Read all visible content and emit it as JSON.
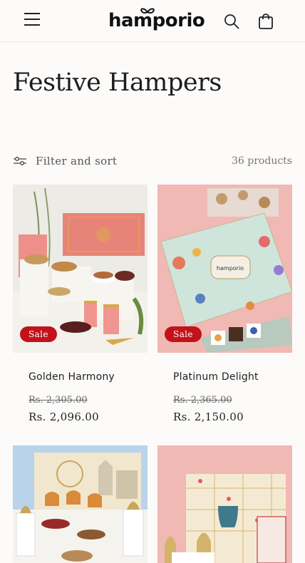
{
  "header": {
    "logo": "hamporio",
    "menu_icon": "hamburger-menu-icon",
    "search_icon": "search-icon",
    "cart_icon": "shopping-bag-icon"
  },
  "collection": {
    "title": "Festive Hampers",
    "filter_label": "Filter and sort",
    "product_count": "36 products"
  },
  "products": [
    {
      "name": "Golden Harmony",
      "badge": "Sale",
      "regular_price": "Rs. 2,305.00",
      "sale_price": "Rs. 2,096.00"
    },
    {
      "name": "Platinum Delight",
      "badge": "Sale",
      "regular_price": "Rs. 2,365.00",
      "sale_price": "Rs. 2,150.00"
    },
    {
      "name": "",
      "badge": "",
      "regular_price": "",
      "sale_price": ""
    },
    {
      "name": "",
      "badge": "",
      "regular_price": "",
      "sale_price": ""
    }
  ],
  "colors": {
    "sale_badge": "#c3121c",
    "background": "#fcfbfa",
    "text": "#1f1f1f"
  }
}
